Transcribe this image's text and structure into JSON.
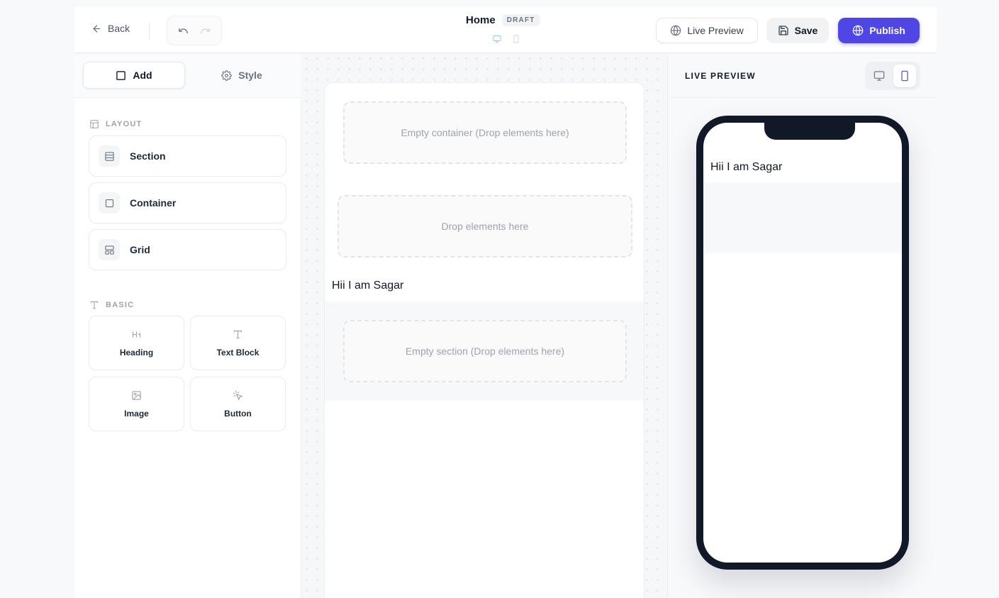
{
  "header": {
    "back_label": "Back",
    "page_title": "Home",
    "status_badge": "DRAFT",
    "live_preview_label": "Live Preview",
    "save_label": "Save",
    "publish_label": "Publish"
  },
  "sidebar": {
    "tabs": [
      {
        "label": "Add",
        "icon": "square-icon",
        "active": true
      },
      {
        "label": "Style",
        "icon": "gear-icon",
        "active": false
      }
    ],
    "layout_heading": "LAYOUT",
    "layout_items": [
      {
        "label": "Section",
        "icon": "section-icon"
      },
      {
        "label": "Container",
        "icon": "container-icon"
      },
      {
        "label": "Grid",
        "icon": "grid-icon"
      }
    ],
    "basic_heading": "BASIC",
    "basic_items": [
      {
        "label": "Heading",
        "icon": "heading-icon"
      },
      {
        "label": "Text Block",
        "icon": "text-icon"
      },
      {
        "label": "Image",
        "icon": "image-icon"
      },
      {
        "label": "Button",
        "icon": "cursor-click-icon"
      }
    ]
  },
  "canvas": {
    "container_placeholder": "Empty container (Drop elements here)",
    "drop_placeholder": "Drop elements here",
    "text_content": "Hii I am Sagar",
    "section_placeholder": "Empty section (Drop elements here)"
  },
  "preview": {
    "title": "LIVE PREVIEW",
    "active_device": "mobile",
    "text_content": "Hii I am Sagar"
  },
  "colors": {
    "primary": "#4f46e5",
    "phone_frame": "#111827"
  }
}
